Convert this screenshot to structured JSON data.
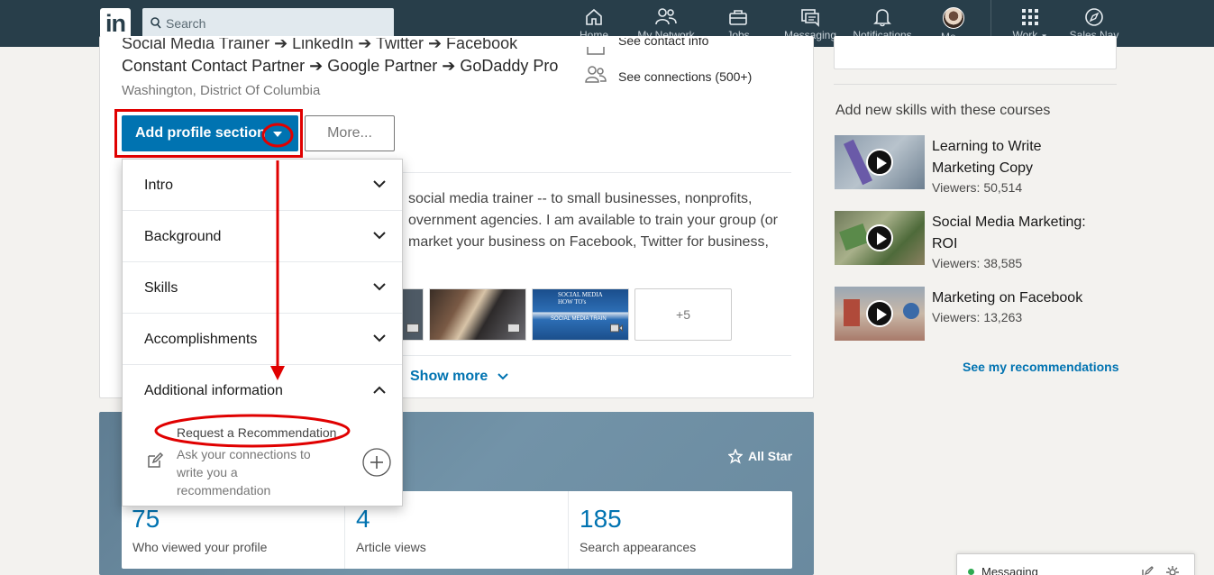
{
  "nav": {
    "logo": "in",
    "search_placeholder": "Search",
    "items": [
      {
        "label": "Home",
        "icon": "home-icon"
      },
      {
        "label": "My Network",
        "icon": "network-icon"
      },
      {
        "label": "Jobs",
        "icon": "briefcase-icon"
      },
      {
        "label": "Messaging",
        "icon": "messaging-icon"
      },
      {
        "label": "Notifications",
        "icon": "bell-icon"
      },
      {
        "label": "Me",
        "icon": "avatar"
      },
      {
        "label": "Work",
        "icon": "grid-icon"
      },
      {
        "label": "Sales Nav",
        "icon": "compass-icon"
      }
    ]
  },
  "profile": {
    "headline_partial": "Social Media Trainer ➔ LinkedIn ➔ Twitter ➔ Facebook",
    "headline_line2": "Constant Contact Partner ➔ Google Partner ➔ GoDaddy Pro",
    "location": "Washington, District Of Columbia",
    "contact_info": "See contact info",
    "connections": "See connections (500+)",
    "add_section_label": "Add profile section",
    "more_label": "More...",
    "summary_line1": "social media trainer -- to small businesses, nonprofits,",
    "summary_line2": "overnment agencies. I am available to train your group (or",
    "summary_line3": "market your business on Facebook, Twitter for business,",
    "media_more": "+5",
    "show_more": "Show more",
    "thumb2_text": "SOCIAL MEDIA HOW TO's",
    "thumb2_sub": "SOCIAL MEDIA TRAIN"
  },
  "dropdown": {
    "sections": [
      {
        "label": "Intro"
      },
      {
        "label": "Background"
      },
      {
        "label": "Skills"
      },
      {
        "label": "Accomplishments"
      },
      {
        "label": "Additional information"
      }
    ],
    "sub_item": {
      "title": "Request a Recommendation",
      "desc_line1": "Ask your connections to",
      "desc_line2": "write you a",
      "desc_line3": "recommendation"
    }
  },
  "dashboard": {
    "badge": "All Star",
    "stats": [
      {
        "value": "75",
        "label": "Who viewed your profile"
      },
      {
        "value": "4",
        "label": "Article views"
      },
      {
        "value": "185",
        "label": "Search appearances"
      }
    ]
  },
  "courses": {
    "heading": "Add new skills with these courses",
    "items": [
      {
        "title_line1": "Learning to Write",
        "title_line2": "Marketing Copy",
        "viewers": "Viewers: 50,514"
      },
      {
        "title_line1": "Social Media Marketing:",
        "title_line2": "ROI",
        "viewers": "Viewers: 38,585"
      },
      {
        "title_line1": "Marketing on Facebook",
        "title_line2": "",
        "viewers": "Viewers: 13,263"
      }
    ],
    "see_more": "See my recommendations"
  },
  "messaging": {
    "label": "Messaging"
  },
  "colors": {
    "brand": "#0073b1",
    "nav_bg": "#283e4a",
    "annotation_red": "#e00000"
  }
}
